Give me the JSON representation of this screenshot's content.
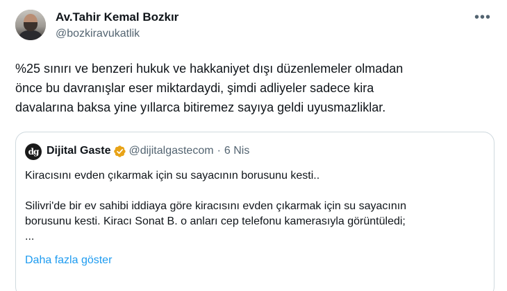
{
  "author": {
    "name": "Av.Tahir Kemal Bozkır",
    "handle": "@bozkiravukatlik"
  },
  "tweet": {
    "lines": [
      "%25 sınırı ve benzeri hukuk ve hakkaniyet dışı düzenlemeler olmadan",
      "önce bu davranışlar eser miktardaydi, şimdi adliyeler sadece kira",
      "davalarına baksa yine yıllarca bitiremez sayıya geldi uyusmazliklar."
    ]
  },
  "quote": {
    "avatar_text": "dg",
    "name": "Dijital Gaste",
    "handle": "@dijitalgastecom",
    "separator": "·",
    "date": "6 Nis",
    "verified_color": "#e8a317",
    "line1": "Kiracısını evden çıkarmak için su sayacının borusunu kesti..",
    "line2": "Silivri'de bir ev sahibi iddiaya göre kiracısını evden çıkarmak için su sayacının",
    "line3": "borusunu kesti. Kiracı Sonat B. o anları cep telefonu kamerasıyla görüntüledi;",
    "line4": "...",
    "show_more": "Daha fazla göster"
  },
  "icons": {
    "more": "more-horizontal-icon",
    "verified": "verified-badge-icon"
  },
  "colors": {
    "link": "#1d9bf0",
    "secondary_text": "#536471",
    "border": "#cfd9de"
  }
}
